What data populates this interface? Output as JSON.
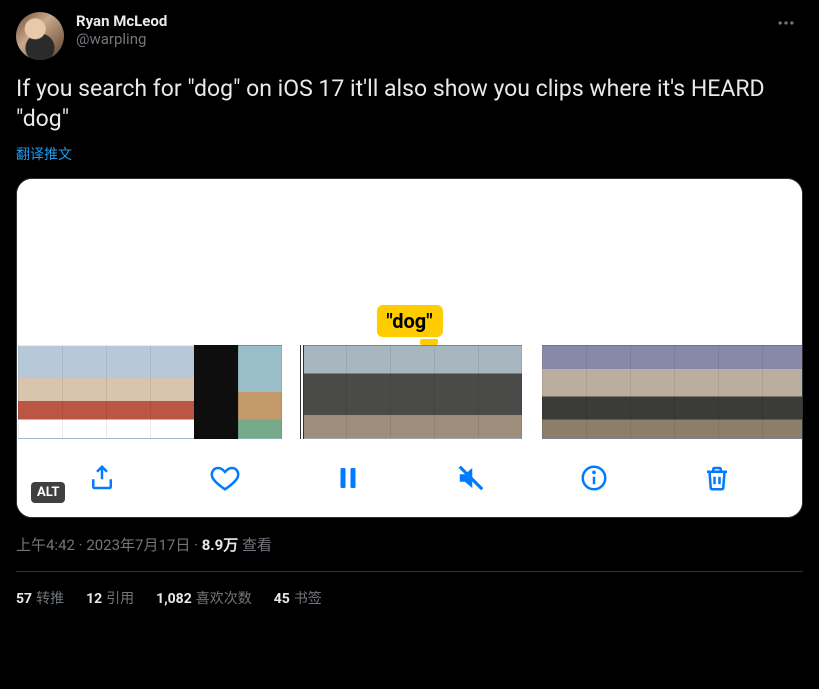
{
  "author": {
    "display_name": "Ryan McLeod",
    "handle": "@warpling"
  },
  "tweet_text": "If you search for \"dog\" on iOS 17 it'll also show you clips where it's HEARD \"dog\"",
  "translate_label": "翻译推文",
  "media": {
    "tooltip_text": "\"dog\"",
    "alt_badge": "ALT"
  },
  "timestamp": {
    "time": "上午4:42",
    "sep": " · ",
    "date": "2023年7月17日",
    "views_number": "8.9万",
    "views_label": " 查看"
  },
  "stats": {
    "retweets": {
      "count": "57",
      "label": "转推"
    },
    "quotes": {
      "count": "12",
      "label": "引用"
    },
    "likes": {
      "count": "1,082",
      "label": "喜欢次数"
    },
    "bookmarks": {
      "count": "45",
      "label": "书签"
    }
  }
}
